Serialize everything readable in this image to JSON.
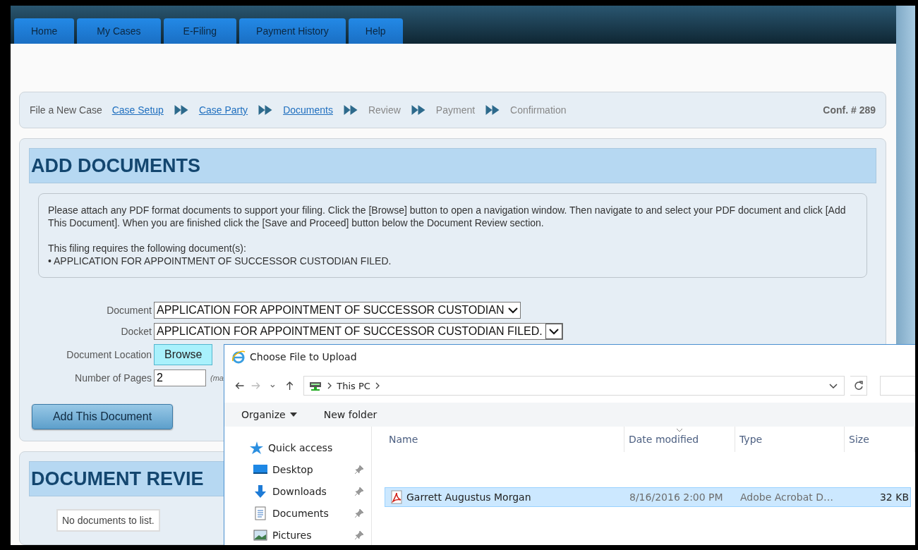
{
  "nav_tabs": [
    {
      "label": "Home"
    },
    {
      "label": "My Cases"
    },
    {
      "label": "E-Filing"
    },
    {
      "label": "Payment History"
    },
    {
      "label": "Help"
    }
  ],
  "breadcrumb": {
    "title": "File a New Case",
    "steps": [
      {
        "label": "Case Setup",
        "kind": "link"
      },
      {
        "label": "Case Party",
        "kind": "link"
      },
      {
        "label": "Documents",
        "kind": "link"
      },
      {
        "label": "Review",
        "kind": "text"
      },
      {
        "label": "Payment",
        "kind": "text"
      },
      {
        "label": "Confirmation",
        "kind": "text"
      }
    ],
    "conf": "Conf. # 289"
  },
  "add_documents": {
    "heading": "ADD DOCUMENTS",
    "instructions": [
      "Please attach any PDF format documents to support your filing. Click the [Browse] button to open a navigation window. Then navigate to and select your PDF document and click [Add This Document]. When you are finished click the [Save and Proceed] button below the Document Review section.",
      "This filing requires the following document(s):",
      "• APPLICATION FOR APPOINTMENT OF SUCCESSOR CUSTODIAN FILED."
    ],
    "document": {
      "label": "Document",
      "value": "APPLICATION FOR APPOINTMENT OF SUCCESSOR CUSTODIAN"
    },
    "docket": {
      "label": "Docket",
      "value": "APPLICATION FOR APPOINTMENT OF SUCCESSOR CUSTODIAN FILED."
    },
    "location": {
      "label": "Document Location",
      "button": "Browse"
    },
    "pages": {
      "label": "Number of Pages",
      "value": "2",
      "note": "(ma"
    },
    "add_button": "Add This Document"
  },
  "document_review": {
    "heading": "DOCUMENT REVIE",
    "empty_text": "No documents to list."
  },
  "file_dialog": {
    "title": "Choose File to Upload",
    "address": "This PC",
    "toolbar": [
      {
        "label": "Organize",
        "dropdown": true
      },
      {
        "label": "New folder",
        "dropdown": false
      }
    ],
    "nav_items": [
      {
        "label": "Quick access",
        "kind": "star",
        "pinned": false
      },
      {
        "label": "Desktop",
        "kind": "desktop",
        "pinned": true
      },
      {
        "label": "Downloads",
        "kind": "download",
        "pinned": true
      },
      {
        "label": "Documents",
        "kind": "document",
        "pinned": true
      },
      {
        "label": "Pictures",
        "kind": "picture",
        "pinned": true
      }
    ],
    "columns": [
      "Name",
      "Date modified",
      "Type",
      "Size"
    ],
    "files": [
      {
        "name": "Garrett Augustus Morgan",
        "date": "8/16/2016 2:00 PM",
        "type": "Adobe Acrobat D…",
        "size": "32 KB",
        "selected": true
      }
    ]
  }
}
